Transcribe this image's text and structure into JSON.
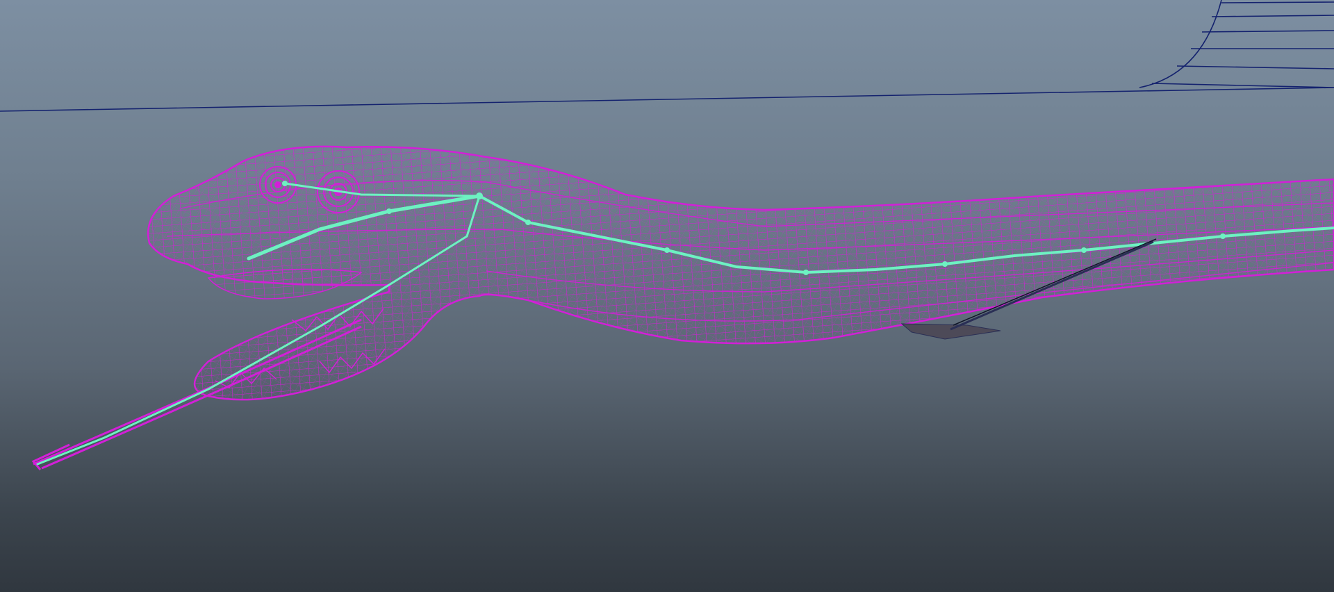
{
  "viewport": {
    "panel": "3d-perspective-viewport",
    "background_colors": {
      "top": "#7d8fa2",
      "bottom": "#30373f"
    }
  },
  "scene": {
    "objects": [
      {
        "name": "ground-plane-grid",
        "display": "wireframe",
        "color": "#14226e"
      },
      {
        "name": "snake-mesh",
        "display": "wireframe",
        "color": "#d31fd8",
        "selected": true
      },
      {
        "name": "spine-joint-chain",
        "display": "joints",
        "color": "#6df2c2"
      },
      {
        "name": "ik-handle",
        "display": "handle",
        "color": "#2a2f55"
      }
    ]
  }
}
